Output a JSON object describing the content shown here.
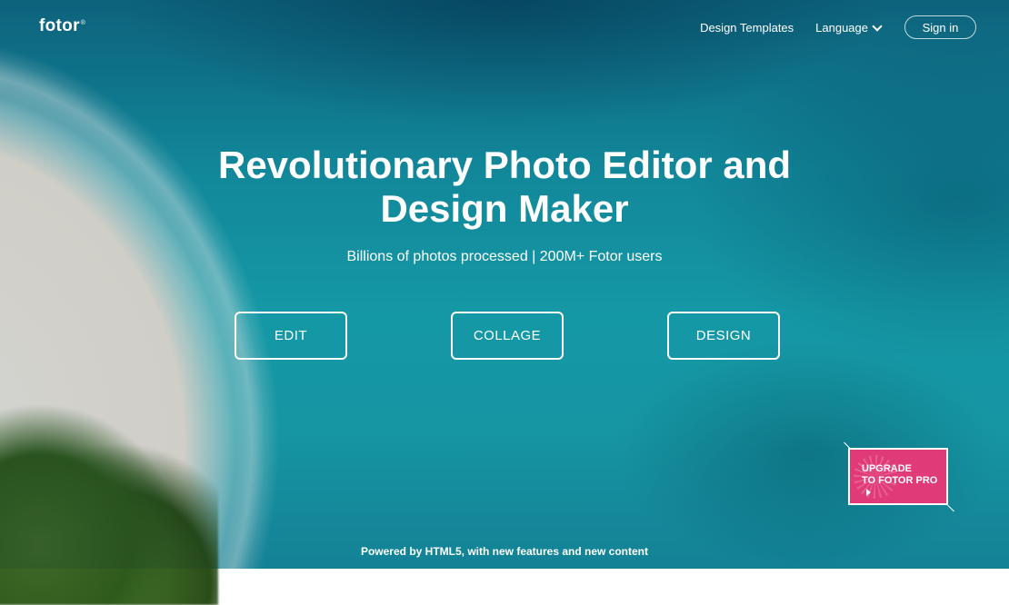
{
  "brand": {
    "logo_text": "fotor",
    "logo_mark": "®"
  },
  "nav": {
    "design_templates": "Design Templates",
    "language": "Language",
    "sign_in": "Sign in"
  },
  "hero": {
    "headline_line1": "Revolutionary Photo Editor and",
    "headline_line2": "Design Maker",
    "subline": "Billions of photos processed | 200M+ Fotor users"
  },
  "actions": {
    "edit": "EDIT",
    "collage": "COLLAGE",
    "design": "DESIGN"
  },
  "upgrade": {
    "line1": "UPGRADE",
    "line2": "TO FOTOR PRO"
  },
  "footer": {
    "text": "Powered by HTML5, with new features and new content"
  },
  "colors": {
    "accent_pink": "#e03a78",
    "water": "#1aa6b3"
  }
}
